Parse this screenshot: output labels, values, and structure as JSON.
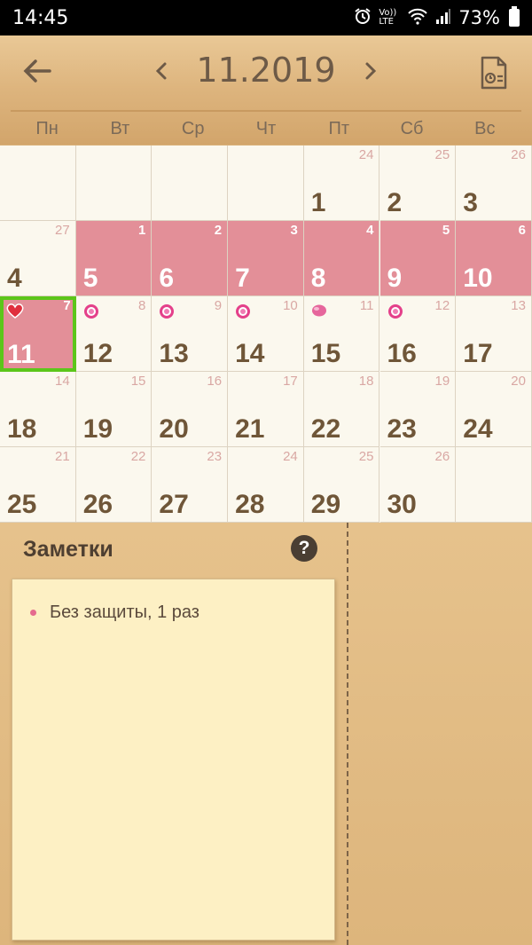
{
  "status_bar": {
    "time": "14:45",
    "battery": "73%",
    "network_label": "Vo)) LTE",
    "icons": [
      "alarm-icon",
      "volte-icon",
      "wifi-icon",
      "signal-icon",
      "battery-icon"
    ]
  },
  "header": {
    "month": "11.2019",
    "back_icon": "arrow-left-icon",
    "prev_icon": "chevron-left-icon",
    "next_icon": "chevron-right-icon",
    "report_icon": "report-document-icon",
    "weekdays": [
      "Пн",
      "Вт",
      "Ср",
      "Чт",
      "Пт",
      "Сб",
      "Вс"
    ]
  },
  "calendar": {
    "weeks": [
      [
        {
          "day": "",
          "cycle": "",
          "period": false
        },
        {
          "day": "",
          "cycle": "",
          "period": false
        },
        {
          "day": "",
          "cycle": "",
          "period": false
        },
        {
          "day": "",
          "cycle": "",
          "period": false
        },
        {
          "day": "1",
          "cycle": "24",
          "period": false
        },
        {
          "day": "2",
          "cycle": "25",
          "period": false
        },
        {
          "day": "3",
          "cycle": "26",
          "period": false
        }
      ],
      [
        {
          "day": "4",
          "cycle": "27",
          "period": false
        },
        {
          "day": "5",
          "cycle": "1",
          "period": true
        },
        {
          "day": "6",
          "cycle": "2",
          "period": true
        },
        {
          "day": "7",
          "cycle": "3",
          "period": true
        },
        {
          "day": "8",
          "cycle": "4",
          "period": true
        },
        {
          "day": "9",
          "cycle": "5",
          "period": true
        },
        {
          "day": "10",
          "cycle": "6",
          "period": true
        }
      ],
      [
        {
          "day": "11",
          "cycle": "7",
          "period": true,
          "today": true,
          "marker": "heart-icon"
        },
        {
          "day": "12",
          "cycle": "8",
          "period": false,
          "marker": "flower-icon"
        },
        {
          "day": "13",
          "cycle": "9",
          "period": false,
          "marker": "flower-icon"
        },
        {
          "day": "14",
          "cycle": "10",
          "period": false,
          "marker": "flower-icon"
        },
        {
          "day": "15",
          "cycle": "11",
          "period": false,
          "marker": "egg-icon"
        },
        {
          "day": "16",
          "cycle": "12",
          "period": false,
          "marker": "flower-icon"
        },
        {
          "day": "17",
          "cycle": "13",
          "period": false
        }
      ],
      [
        {
          "day": "18",
          "cycle": "14",
          "period": false
        },
        {
          "day": "19",
          "cycle": "15",
          "period": false
        },
        {
          "day": "20",
          "cycle": "16",
          "period": false
        },
        {
          "day": "21",
          "cycle": "17",
          "period": false
        },
        {
          "day": "22",
          "cycle": "18",
          "period": false
        },
        {
          "day": "23",
          "cycle": "19",
          "period": false
        },
        {
          "day": "24",
          "cycle": "20",
          "period": false
        }
      ],
      [
        {
          "day": "25",
          "cycle": "21",
          "period": false
        },
        {
          "day": "26",
          "cycle": "22",
          "period": false
        },
        {
          "day": "27",
          "cycle": "23",
          "period": false
        },
        {
          "day": "28",
          "cycle": "24",
          "period": false
        },
        {
          "day": "29",
          "cycle": "25",
          "period": false
        },
        {
          "day": "30",
          "cycle": "26",
          "period": false
        },
        {
          "day": "",
          "cycle": "",
          "period": false
        }
      ]
    ]
  },
  "notes": {
    "title": "Заметки",
    "help_icon": "help-icon",
    "items": [
      "Без защиты, 1 раз"
    ]
  },
  "colors": {
    "period": "#e38f98",
    "today_border": "#5cc61a",
    "day_text": "#6f5638",
    "note_bullet": "#e56a8e"
  }
}
